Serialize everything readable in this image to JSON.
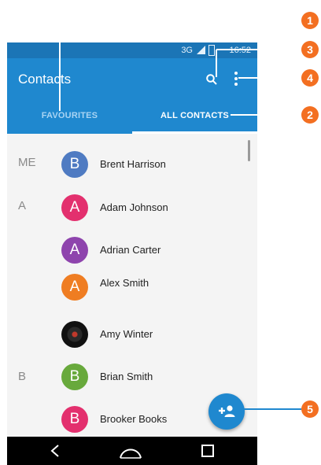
{
  "status_bar": {
    "network": "3G",
    "time": "16:52"
  },
  "app_bar": {
    "title": "Contacts",
    "search_icon": "search-icon",
    "more_icon": "more-vert-icon"
  },
  "tabs": [
    {
      "label": "FAVOURITES",
      "selected": false
    },
    {
      "label": "ALL CONTACTS",
      "selected": true
    }
  ],
  "sections": [
    {
      "label": "ME"
    },
    {
      "label": "A"
    },
    {
      "label": "B"
    }
  ],
  "contacts": [
    {
      "initial": "B",
      "name": "Brent Harrison",
      "color": "#4f7bc2"
    },
    {
      "initial": "A",
      "name": "Adam Johnson",
      "color": "#e3306e"
    },
    {
      "initial": "A",
      "name": "Adrian Carter",
      "color": "#8e44ad"
    },
    {
      "initial": "A",
      "name": "Alex Smith",
      "color": "#ef7d22"
    },
    {
      "initial": "",
      "name": "Amy Winter",
      "color": "#1b1b1b",
      "photo": true
    },
    {
      "initial": "B",
      "name": "Brian Smith",
      "color": "#68a93c"
    },
    {
      "initial": "B",
      "name": "Brooker Books",
      "color": "#e3306e"
    }
  ],
  "fab": {
    "icon": "add-contact-icon"
  },
  "nav": {
    "back_icon": "back-icon",
    "home_icon": "home-icon",
    "recents_icon": "recents-icon"
  },
  "callouts": [
    "1",
    "2",
    "3",
    "4",
    "5"
  ],
  "colors": {
    "primary": "#1f88cf",
    "status_bar": "#1b75b6",
    "accent_callout": "#f36f21"
  }
}
